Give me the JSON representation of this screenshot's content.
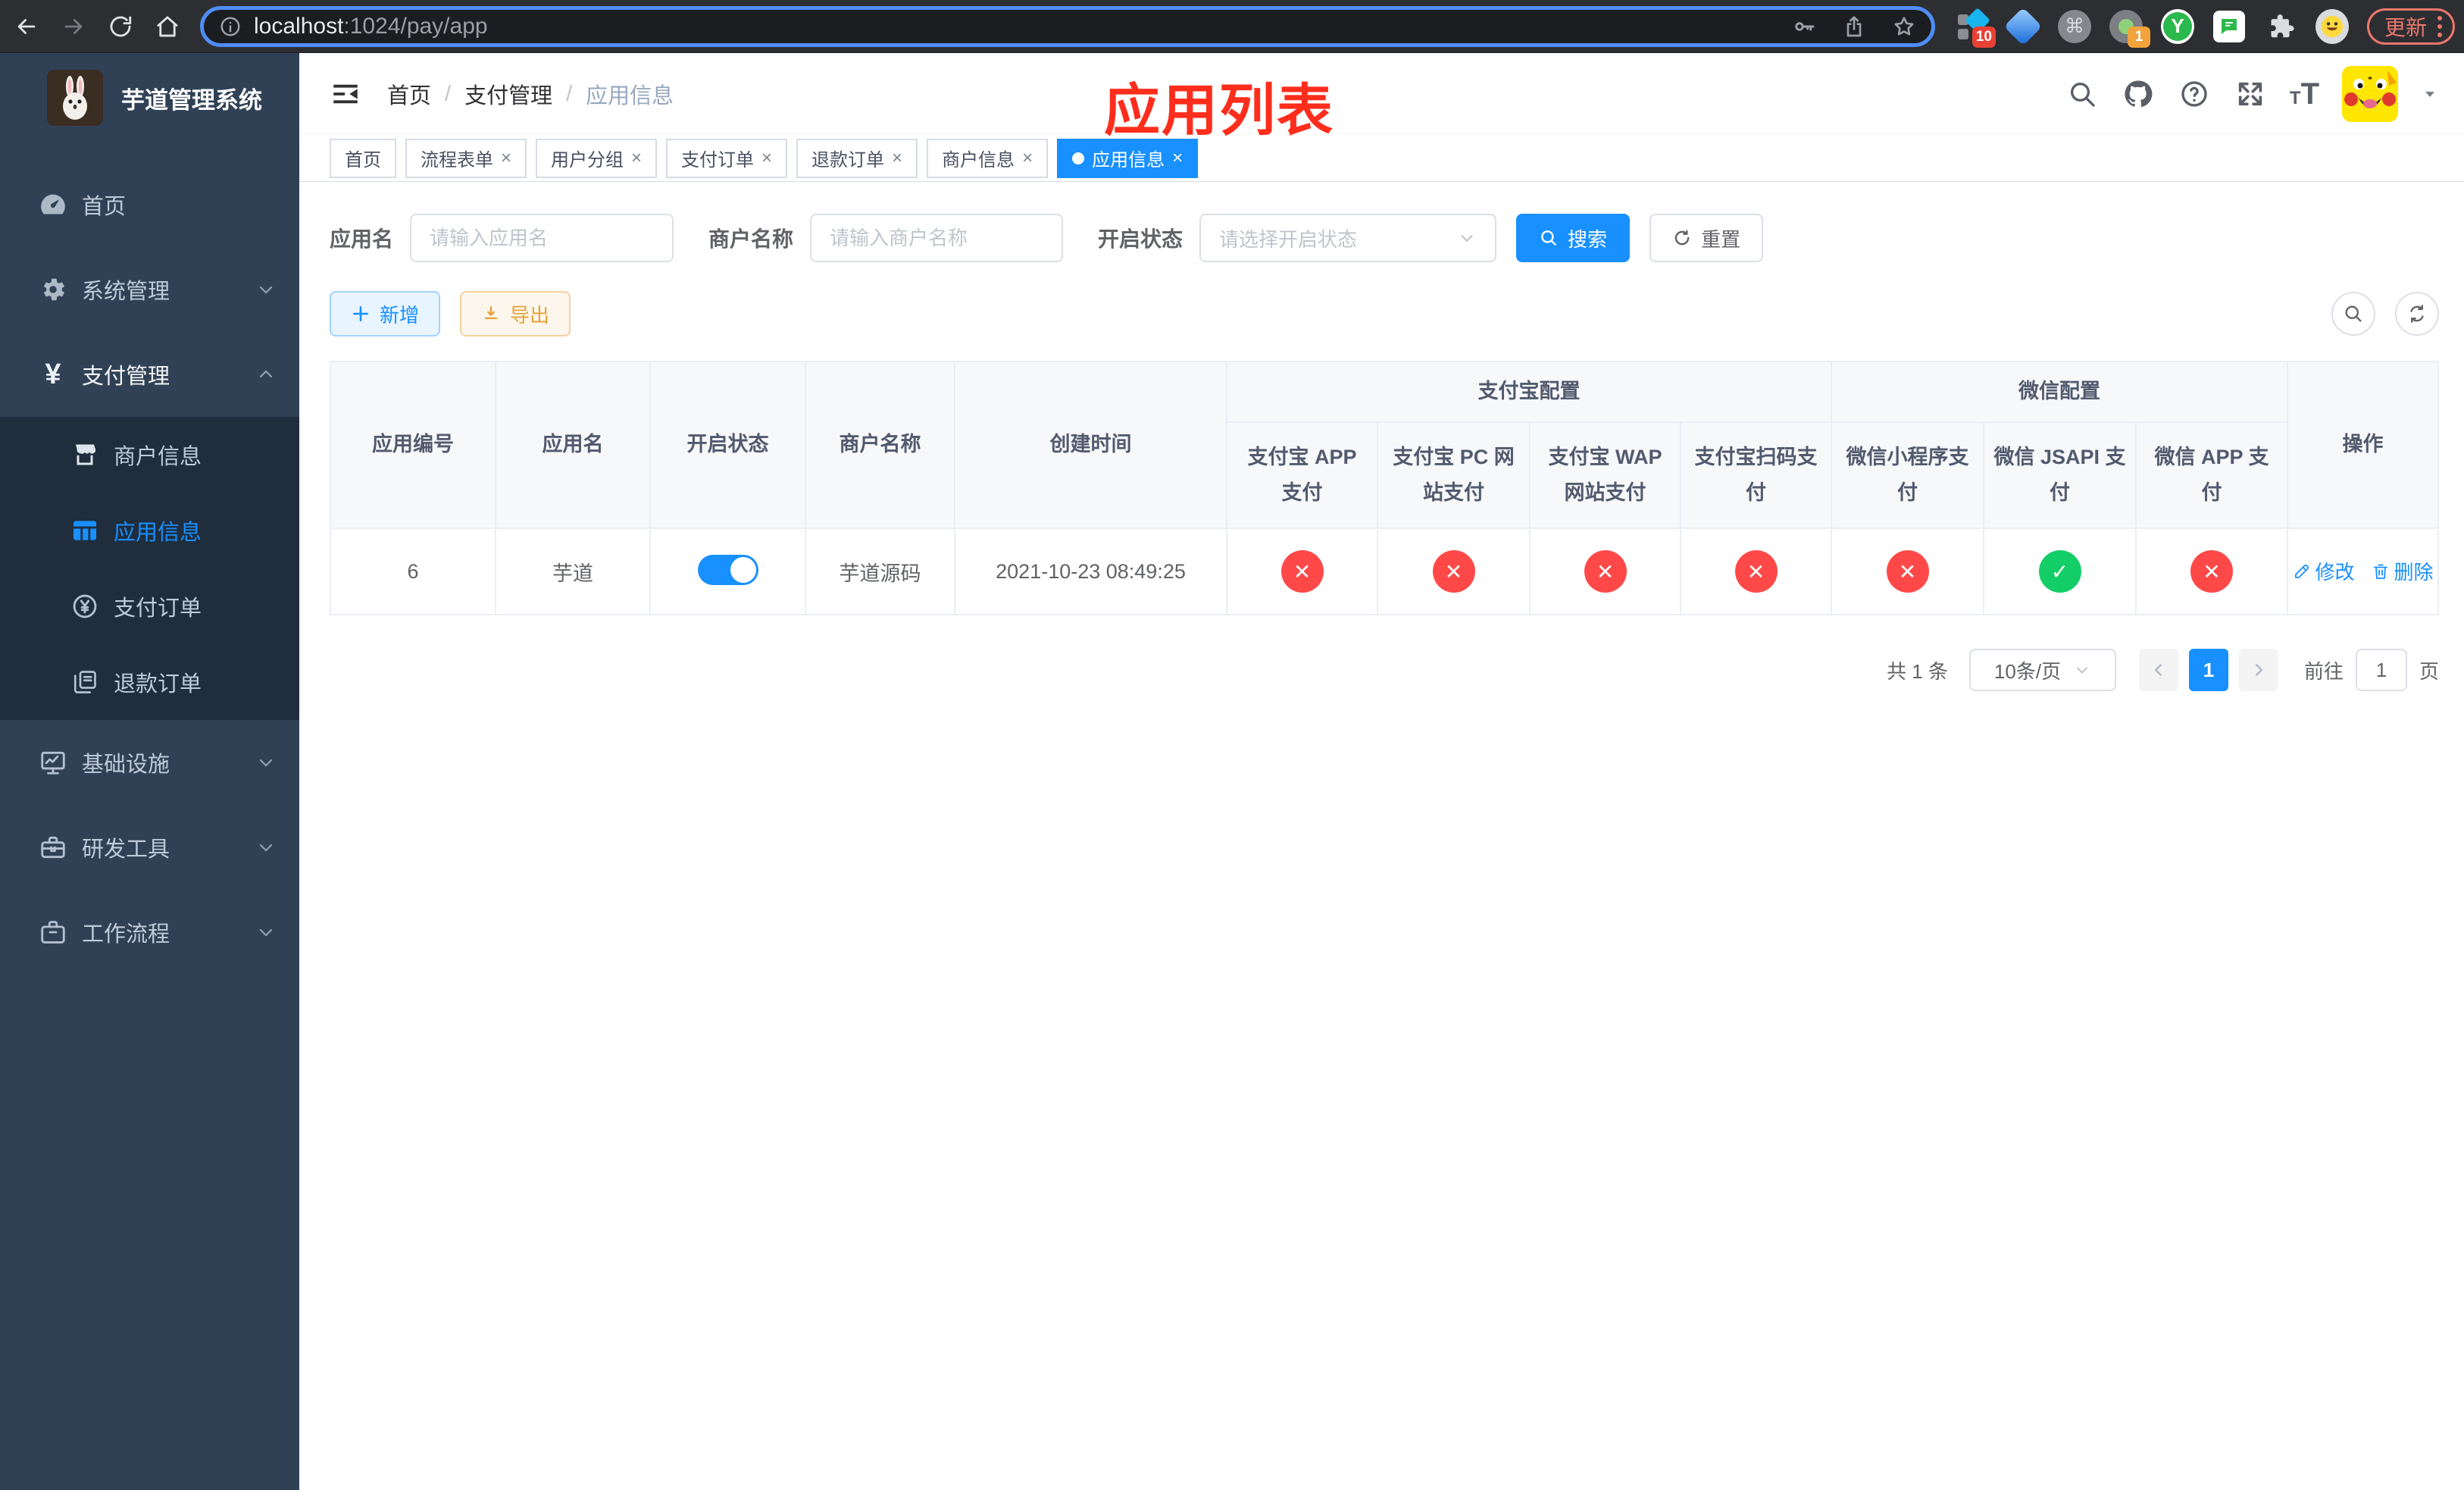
{
  "browser": {
    "url_host": "localhost",
    "url_path": ":1024/pay/app",
    "update_label": "更新",
    "badge_extensions": "10",
    "badge_session": "1",
    "ext_y": "Y"
  },
  "sidebar": {
    "title": "芋道管理系统",
    "menu": [
      {
        "label": "首页",
        "icon": "dashboard-icon"
      },
      {
        "label": "系统管理",
        "icon": "gear-icon",
        "chevron": "down"
      },
      {
        "label": "支付管理",
        "icon": "yen-icon",
        "chevron": "up",
        "expanded": true
      },
      {
        "label": "基础设施",
        "icon": "monitor-icon",
        "chevron": "down"
      },
      {
        "label": "研发工具",
        "icon": "toolbox-icon",
        "chevron": "down"
      },
      {
        "label": "工作流程",
        "icon": "briefcase-icon",
        "chevron": "down"
      }
    ],
    "submenu": [
      {
        "label": "商户信息",
        "icon": "shop-icon",
        "active": false
      },
      {
        "label": "应用信息",
        "icon": "grid-icon",
        "active": true
      },
      {
        "label": "支付订单",
        "icon": "pay-order-icon",
        "active": false
      },
      {
        "label": "退款订单",
        "icon": "refund-icon",
        "active": false
      }
    ]
  },
  "header": {
    "breadcrumb": [
      "首页",
      "支付管理",
      "应用信息"
    ],
    "breadcrumb_sep": "/",
    "annotation": "应用列表"
  },
  "tabs": [
    {
      "label": "首页",
      "closable": false,
      "active": false
    },
    {
      "label": "流程表单",
      "closable": true,
      "active": false
    },
    {
      "label": "用户分组",
      "closable": true,
      "active": false
    },
    {
      "label": "支付订单",
      "closable": true,
      "active": false
    },
    {
      "label": "退款订单",
      "closable": true,
      "active": false
    },
    {
      "label": "商户信息",
      "closable": true,
      "active": false
    },
    {
      "label": "应用信息",
      "closable": true,
      "active": true
    }
  ],
  "filters": {
    "app_name_label": "应用名",
    "app_name_placeholder": "请输入应用名",
    "merchant_label": "商户名称",
    "merchant_placeholder": "请输入商户名称",
    "status_label": "开启状态",
    "status_placeholder": "请选择开启状态",
    "search_label": "搜索",
    "reset_label": "重置"
  },
  "toolbar": {
    "add_label": "新增",
    "export_label": "导出"
  },
  "table": {
    "simple_columns": [
      "应用编号",
      "应用名",
      "开启状态",
      "商户名称",
      "创建时间"
    ],
    "group_alipay": "支付宝配置",
    "group_wechat": "微信配置",
    "action_column": "操作",
    "pay_columns": [
      "支付宝 APP 支付",
      "支付宝 PC 网站支付",
      "支付宝 WAP 网站支付",
      "支付宝扫码支付",
      "微信小程序支付",
      "微信 JSAPI 支付",
      "微信 APP 支付"
    ],
    "row": {
      "id": "6",
      "name": "芋道",
      "enabled": true,
      "merchant": "芋道源码",
      "created_at": "2021-10-23 08:49:25",
      "statuses": [
        "fail",
        "fail",
        "fail",
        "fail",
        "fail",
        "success",
        "fail"
      ],
      "edit_label": "修改",
      "delete_label": "删除"
    }
  },
  "pagination": {
    "total": "共 1 条",
    "page_size": "10条/页",
    "current_page": "1",
    "goto_label": "前往",
    "goto_value": "1",
    "page_unit": "页"
  },
  "colors": {
    "primary": "#1890ff",
    "success": "#13ce66",
    "danger": "#ff4949",
    "warning": "#e6a23c",
    "sidebar_bg": "#304156",
    "submenu_bg": "#1f2d3d",
    "annotation_red": "#fe2d1c"
  }
}
